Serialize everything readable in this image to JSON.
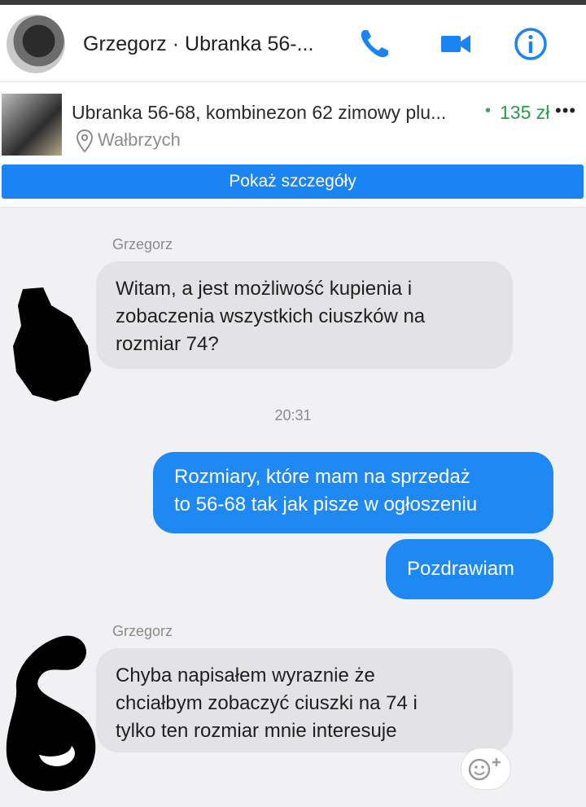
{
  "header": {
    "title": "Grzegorz · Ubranka 56-...",
    "icons": [
      "phone-icon",
      "video-icon",
      "info-icon"
    ],
    "accent_color": "#1a85f2"
  },
  "listing": {
    "title": "Ubranka 56-68, kombinezon 62 zimowy plu...",
    "price": "135 zł",
    "location": "Wałbrzych",
    "details_button": "Pokaż szczegóły",
    "price_color": "#2e9b4b"
  },
  "messages": [
    {
      "sender": "Grzegorz",
      "direction": "in",
      "lines": [
        "Witam, a jest możliwość kupienia i",
        "zobaczenia wszystkich ciuszków na",
        "rozmiar 74?"
      ]
    },
    {
      "timestamp": "20:31"
    },
    {
      "direction": "out",
      "lines": [
        "Rozmiary, które mam na sprzedaż",
        "to 56-68 tak jak pisze w ogłoszeniu"
      ]
    },
    {
      "direction": "out",
      "lines": [
        "Pozdrawiam"
      ]
    },
    {
      "sender": "Grzegorz",
      "direction": "in",
      "lines": [
        "Chyba napisałem wyraznie że",
        "chciałbym zobaczyć ciuszki na 74 i",
        "tylko ten rozmiar mnie interesuje"
      ]
    }
  ],
  "reaction_button": {
    "icon": "smiley-plus-icon"
  }
}
